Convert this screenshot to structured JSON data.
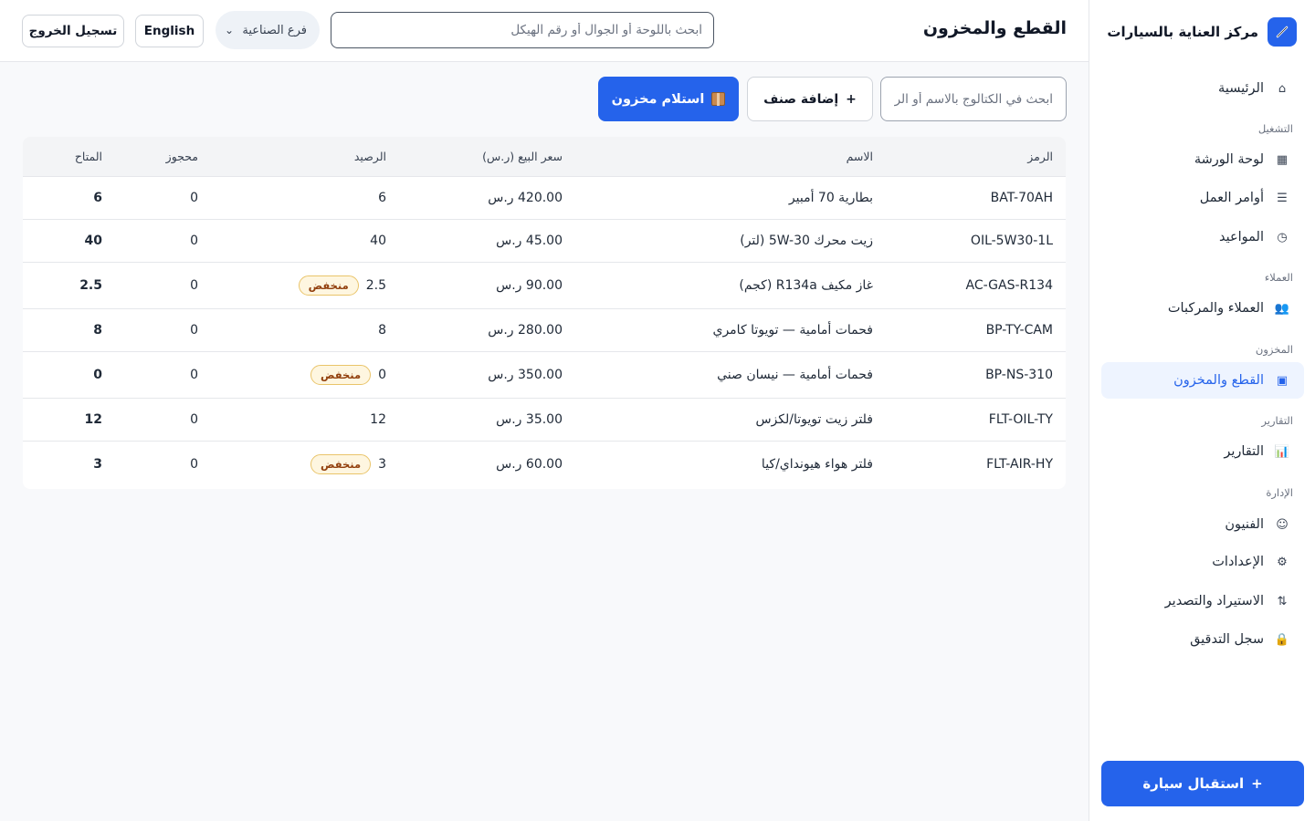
{
  "sidebar": {
    "brand": "مركز العناية بالسيارات",
    "home": "الرئيسية",
    "sections": {
      "operations": "التشغيل",
      "customers": "العملاء",
      "inventory": "المخزون",
      "reports": "التقارير",
      "admin": "الإدارة"
    },
    "items": {
      "workshop_board": "لوحة الورشة",
      "work_orders": "أوامر العمل",
      "appointments": "المواعيد",
      "customers_vehicles": "العملاء والمركبات",
      "parts_inventory": "القطع والمخزون",
      "reports": "التقارير",
      "technicians": "الفنيون",
      "settings": "الإعدادات",
      "import_export": "الاستيراد والتصدير",
      "audit_log": "سجل التدقيق"
    },
    "icons": {
      "home": "⌂",
      "workshop_board": "▦",
      "work_orders": "☰",
      "appointments": "◷",
      "customers_vehicles": "👥",
      "parts_inventory": "▣",
      "reports": "📊",
      "technicians": "☺",
      "settings": "⚙",
      "import_export": "⇅",
      "audit_log": "🔒"
    },
    "reception_button": "استقبال سيارة",
    "reception_icon": "+"
  },
  "header": {
    "title": "القطع والمخزون",
    "search_placeholder": "ابحث باللوحة أو الجوال أو رقم الهيكل",
    "branch": "فرع الصناعية",
    "language_button": "English",
    "logout_button": "تسجيل الخروج"
  },
  "toolbar": {
    "catalog_search_placeholder": "ابحث في الكتالوج بالاسم أو الرمز",
    "add_item_icon": "+",
    "add_item_label": "إضافة صنف",
    "receive_stock_label": "استلام مخزون"
  },
  "table": {
    "columns": {
      "code": "الرمز",
      "name": "الاسم",
      "price": "سعر البيع (ر.س)",
      "balance": "الرصيد",
      "reserved": "محجوز",
      "available": "المتاح"
    },
    "low_badge": "منخفض",
    "rows": [
      {
        "code": "BAT-70AH",
        "name": "بطارية 70 أمبير",
        "price": "420.00 ر.س",
        "balance": "6",
        "low": false,
        "reserved": "0",
        "available": "6"
      },
      {
        "code": "OIL-5W30-1L",
        "name": "زيت محرك 5W-30 (لتر)",
        "price": "45.00 ر.س",
        "balance": "40",
        "low": false,
        "reserved": "0",
        "available": "40"
      },
      {
        "code": "AC-GAS-R134",
        "name": "غاز مكيف R134a (كجم)",
        "price": "90.00 ر.س",
        "balance": "2.5",
        "low": true,
        "reserved": "0",
        "available": "2.5"
      },
      {
        "code": "BP-TY-CAM",
        "name": "فحمات أمامية — تويوتا كامري",
        "price": "280.00 ر.س",
        "balance": "8",
        "low": false,
        "reserved": "0",
        "available": "8"
      },
      {
        "code": "BP-NS-310",
        "name": "فحمات أمامية — نيسان صني",
        "price": "350.00 ر.س",
        "balance": "0",
        "low": true,
        "reserved": "0",
        "available": "0"
      },
      {
        "code": "FLT-OIL-TY",
        "name": "فلتر زيت تويوتا/لكزس",
        "price": "35.00 ر.س",
        "balance": "12",
        "low": false,
        "reserved": "0",
        "available": "12"
      },
      {
        "code": "FLT-AIR-HY",
        "name": "فلتر هواء هيونداي/كيا",
        "price": "60.00 ر.س",
        "balance": "3",
        "low": true,
        "reserved": "0",
        "available": "3"
      }
    ]
  },
  "colors": {
    "primary": "#2563eb",
    "active_bg": "#eef4ff",
    "badge_bg": "#fef6e0",
    "badge_text": "#92400e"
  }
}
